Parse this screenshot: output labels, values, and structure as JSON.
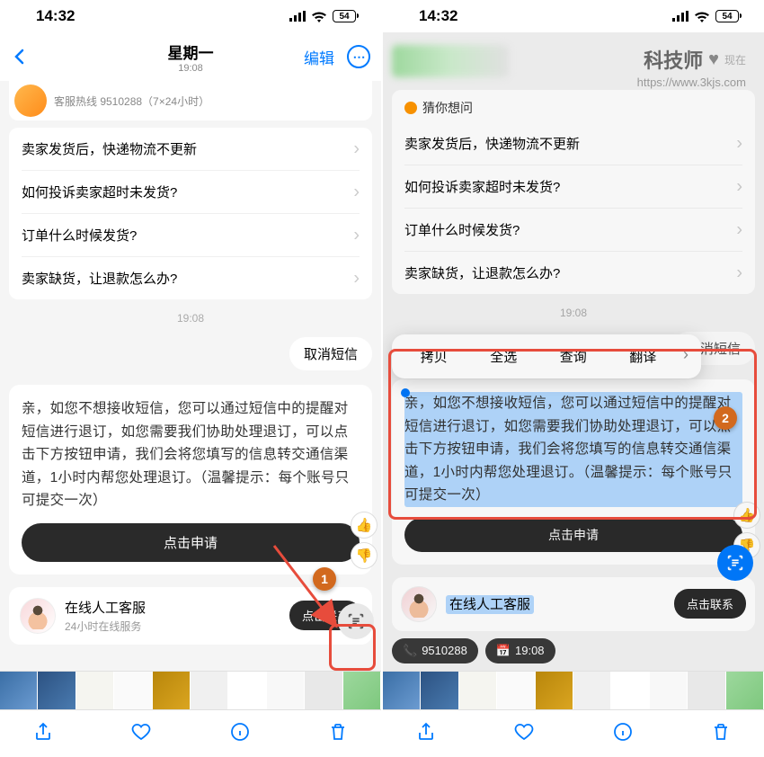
{
  "status": {
    "time": "14:32",
    "battery": "54"
  },
  "nav": {
    "title": "星期一",
    "subtitle": "19:08",
    "edit": "编辑"
  },
  "hotline": "客服热线 9510288（7×24小时）",
  "faq_header": "猜你想问",
  "faq": [
    "卖家发货后，快递物流不更新",
    "如何投诉卖家超时未发货?",
    "订单什么时候发货?",
    "卖家缺货，让退款怎么办?"
  ],
  "timestamp": "19:08",
  "cancel_sms": "取消短信",
  "message": "亲，如您不想接收短信，您可以通过短信中的提醒对短信进行退订，如您需要我们协助处理退订，可以点击下方按钮申请，我们会将您填写的信息转交通信渠道，1小时内帮您处理退订。（温馨提示：每个账号只可提交一次）",
  "apply": "点击申请",
  "agent": {
    "title": "在线人工客服",
    "sub": "24小时在线服务",
    "btn": "点击联系"
  },
  "context": {
    "copy": "拷贝",
    "selectall": "全选",
    "lookup": "查询",
    "translate": "翻译"
  },
  "chips": {
    "phone": "9510288",
    "time": "19:08"
  },
  "watermark": {
    "logo": "科技师",
    "url": "https://www.3kjs.com",
    "time": "现在"
  }
}
